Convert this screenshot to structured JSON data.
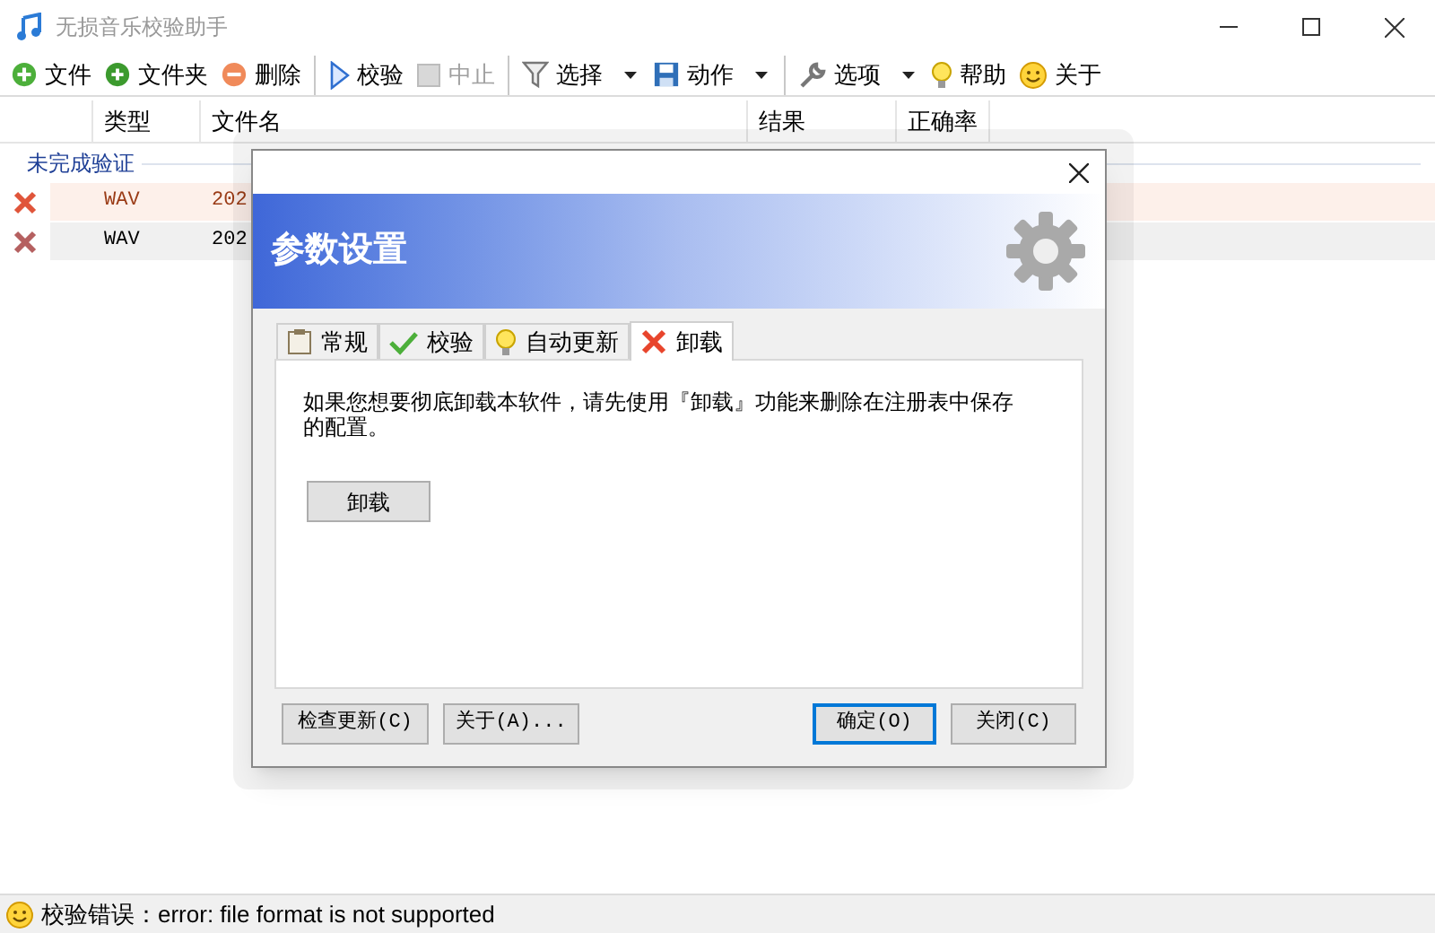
{
  "window": {
    "title": "无损音乐校验助手"
  },
  "toolbar": [
    {
      "label": "文件",
      "disabled": false,
      "dropdown": false,
      "separator_before": false
    },
    {
      "label": "文件夹",
      "disabled": false,
      "dropdown": false,
      "separator_before": false
    },
    {
      "label": "删除",
      "disabled": false,
      "dropdown": false,
      "separator_before": false
    },
    {
      "label": "校验",
      "disabled": false,
      "dropdown": false,
      "separator_before": true
    },
    {
      "label": "中止",
      "disabled": true,
      "dropdown": false,
      "separator_before": false
    },
    {
      "label": "选择",
      "disabled": false,
      "dropdown": true,
      "separator_before": true
    },
    {
      "label": "动作",
      "disabled": false,
      "dropdown": true,
      "separator_before": false
    },
    {
      "label": "选项",
      "disabled": false,
      "dropdown": true,
      "separator_before": true
    },
    {
      "label": "帮助",
      "disabled": false,
      "dropdown": false,
      "separator_before": false
    },
    {
      "label": "关于",
      "disabled": false,
      "dropdown": false,
      "separator_before": false
    }
  ],
  "table": {
    "columns": [
      "类型",
      "文件名",
      "结果",
      "正确率"
    ],
    "group": "未完成验证",
    "rows": [
      {
        "type": "WAV",
        "file": "202",
        "selected": true
      },
      {
        "type": "WAV",
        "file": "202",
        "selected": false
      }
    ]
  },
  "dialog": {
    "header": "参数设置",
    "tabs": [
      {
        "label": "常规",
        "selected": false
      },
      {
        "label": "校验",
        "selected": false
      },
      {
        "label": "自动更新",
        "selected": false
      },
      {
        "label": "卸载",
        "selected": true
      }
    ],
    "message": "如果您想要彻底卸载本软件，请先使用『卸载』功能来删除在注册表中保存的配置。",
    "action_button": "卸载",
    "buttons": [
      {
        "label": "检查更新(C)",
        "default": false
      },
      {
        "label": "关于(A)...",
        "default": false
      },
      {
        "label": "确定(O)",
        "default": true
      },
      {
        "label": "关闭(C)",
        "default": false
      }
    ]
  },
  "status_bar": "校验错误：error: file format is not supported"
}
